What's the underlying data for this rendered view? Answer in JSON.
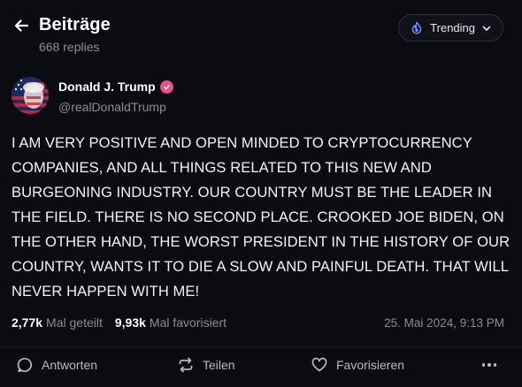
{
  "header": {
    "title": "Beiträge",
    "subtitle": "668 replies",
    "trending_label": "Trending"
  },
  "post": {
    "author_name": "Donald J. Trump",
    "handle": "@realDonaldTrump",
    "text": "I AM VERY POSITIVE AND OPEN MINDED TO CRYPTOCURRENCY COMPANIES, AND ALL THINGS RELATED TO THIS NEW AND BURGEONING INDUSTRY. OUR COUNTRY MUST BE THE LEADER IN THE FIELD. THERE IS NO SECOND PLACE. CROOKED JOE BIDEN, ON THE OTHER HAND, THE WORST PRESIDENT IN THE HISTORY OF OUR COUNTRY, WANTS IT TO DIE A SLOW AND PAINFUL DEATH. THAT WILL NEVER HAPPEN WITH ME!",
    "reposts_count": "2,77k",
    "reposts_label": "Mal geteilt",
    "favorites_count": "9,93k",
    "favorites_label": "Mal favorisiert",
    "timestamp": "25. Mai 2024, 9:13 PM"
  },
  "actions": {
    "reply_label": "Antworten",
    "share_label": "Teilen",
    "favorite_label": "Favorisieren"
  },
  "icons": {
    "back": "arrow-left-icon",
    "trending": "flame-icon",
    "dropdown": "chevron-down-icon",
    "verified": "verified-badge-icon",
    "reply": "speech-bubble-icon",
    "share": "repost-icon",
    "favorite": "heart-icon",
    "more": "more-icon"
  },
  "colors": {
    "background": "#0b0c11",
    "verified_badge": "#e94f86",
    "trending_icon": "#6c8dff"
  }
}
